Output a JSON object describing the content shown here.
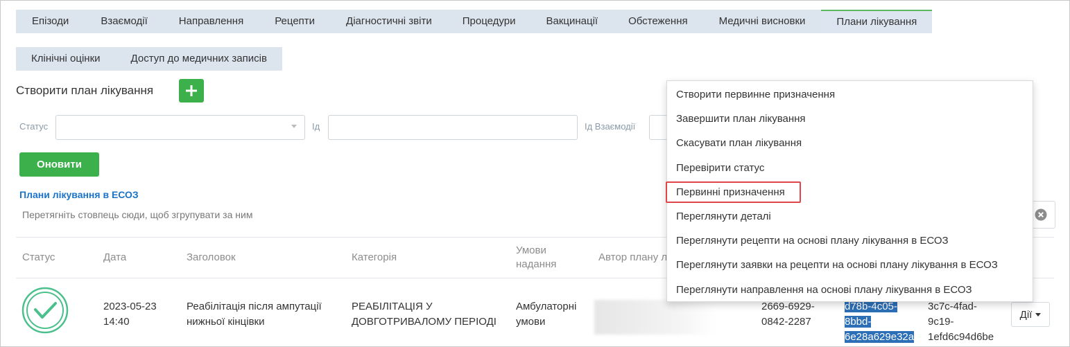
{
  "tabs_row1": [
    {
      "label": "Епізоди"
    },
    {
      "label": "Взаємодії"
    },
    {
      "label": "Направлення"
    },
    {
      "label": "Рецепти"
    },
    {
      "label": "Діагностичні звіти"
    },
    {
      "label": "Процедури"
    },
    {
      "label": "Вакцинації"
    },
    {
      "label": "Обстеження"
    },
    {
      "label": "Медичні висновки"
    },
    {
      "label": "Плани лікування",
      "active": true
    }
  ],
  "tabs_row2": [
    {
      "label": "Клінічні оцінки"
    },
    {
      "label": "Доступ до медичних записів"
    }
  ],
  "create": {
    "label": "Створити план лікування",
    "plus_icon": "plus-icon"
  },
  "filters": {
    "status_label": "Статус",
    "status_value": "",
    "id_label": "Ід",
    "id_value": "",
    "encounter_id_label": "Ід Взаємодії",
    "encounter_id_value": ""
  },
  "refresh_label": "Оновити",
  "section_title": "Плани лікування в ЕСОЗ",
  "group_hint": "Перетягніть стовпець сюди, щоб згрупувати за ним",
  "table": {
    "headers": {
      "status": "Статус",
      "date": "Дата",
      "title": "Заголовок",
      "category": "Категорія",
      "conditions_1": "Умови",
      "conditions_2": "надання",
      "author": "Автор плану л"
    },
    "row": {
      "status_icon": "check-circle-icon",
      "date_1": "2023-05-23",
      "date_2": "14:40",
      "title_1": "Реабілітація після ампутації",
      "title_2": "нижньої кінцівки",
      "category_1": "РЕАБІЛІТАЦІЯ У",
      "category_2": "ДОВГОТРИВАЛОМУ ПЕРІОДІ",
      "conditions_1": "Амбулаторні",
      "conditions_2": "умови",
      "number_1": "2669-6929-",
      "number_2": "0842-2287",
      "id_1": "d78b-4c05-",
      "id_2": "8bbd-",
      "id_3": "6e28a629e32a",
      "id2_1": "3c7c-4fad-",
      "id2_2": "9c19-",
      "id2_3": "1efd6c94d6be"
    }
  },
  "actions_label": "Дії",
  "dropdown": [
    "Створити первинне призначення",
    "Завершити план лікування",
    "Скасувати план лікування",
    "Перевірити статус",
    "Первинні призначення",
    "Переглянути деталі",
    "Переглянути рецепти на основі плану лікування в ЕСОЗ",
    "Переглянути заявки на рецепти на основі плану лікування в ЕСОЗ",
    "Переглянути направлення на основі плану лікування в ЕСОЗ"
  ],
  "colors": {
    "accent_green": "#3cb04a",
    "link_blue": "#1a73c8",
    "highlight_red": "#e0454a",
    "tab_bg": "#dce4ee"
  }
}
